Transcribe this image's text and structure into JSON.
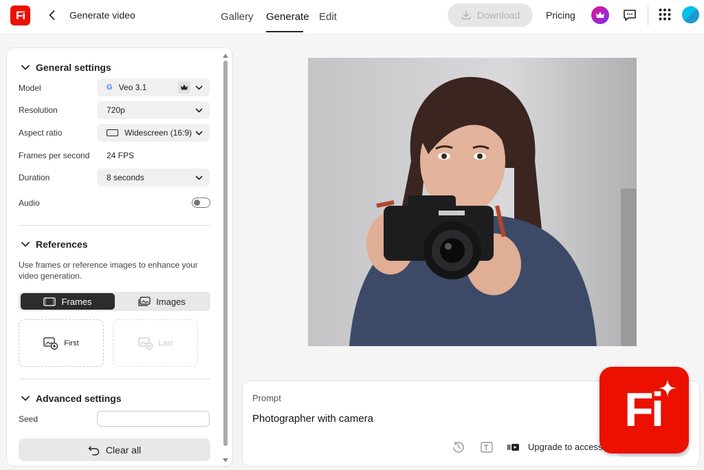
{
  "app": {
    "logo_text": "Fi",
    "page_title": "Generate video"
  },
  "nav": {
    "tabs": [
      {
        "label": "Gallery"
      },
      {
        "label": "Generate"
      },
      {
        "label": "Edit"
      }
    ],
    "active_tab": "Generate"
  },
  "header": {
    "download_label": "Download",
    "pricing_label": "Pricing"
  },
  "general": {
    "title": "General settings",
    "model_label": "Model",
    "model_value": "Veo 3.1",
    "resolution_label": "Resolution",
    "resolution_value": "720p",
    "aspect_label": "Aspect ratio",
    "aspect_value": "Widescreen (16:9)",
    "fps_label": "Frames per second",
    "fps_value": "24 FPS",
    "duration_label": "Duration",
    "duration_value": "8 seconds",
    "audio_label": "Audio",
    "audio_on": false
  },
  "references": {
    "title": "References",
    "help": "Use frames or reference images to enhance your video generation.",
    "frames_label": "Frames",
    "images_label": "Images",
    "first_label": "First",
    "last_label": "Last"
  },
  "advanced": {
    "title": "Advanced settings",
    "seed_label": "Seed",
    "seed_value": ""
  },
  "clear_label": "Clear all",
  "prompt": {
    "label": "Prompt",
    "text": "Photographer with camera",
    "upgrade_label": "Upgrade to access"
  },
  "colors": {
    "brand": "#eb1000",
    "premium_gradient": [
      "#e2188a",
      "#7b2ff7"
    ]
  },
  "icons": [
    "back-icon",
    "download-icon",
    "crown-icon",
    "chat-icon",
    "apps-grid-icon",
    "chevron-down-icon",
    "google-icon",
    "aspect-rect-icon",
    "frames-icon",
    "images-icon",
    "add-image-icon",
    "undo-icon",
    "history-icon",
    "text-style-icon",
    "video-settings-icon"
  ]
}
